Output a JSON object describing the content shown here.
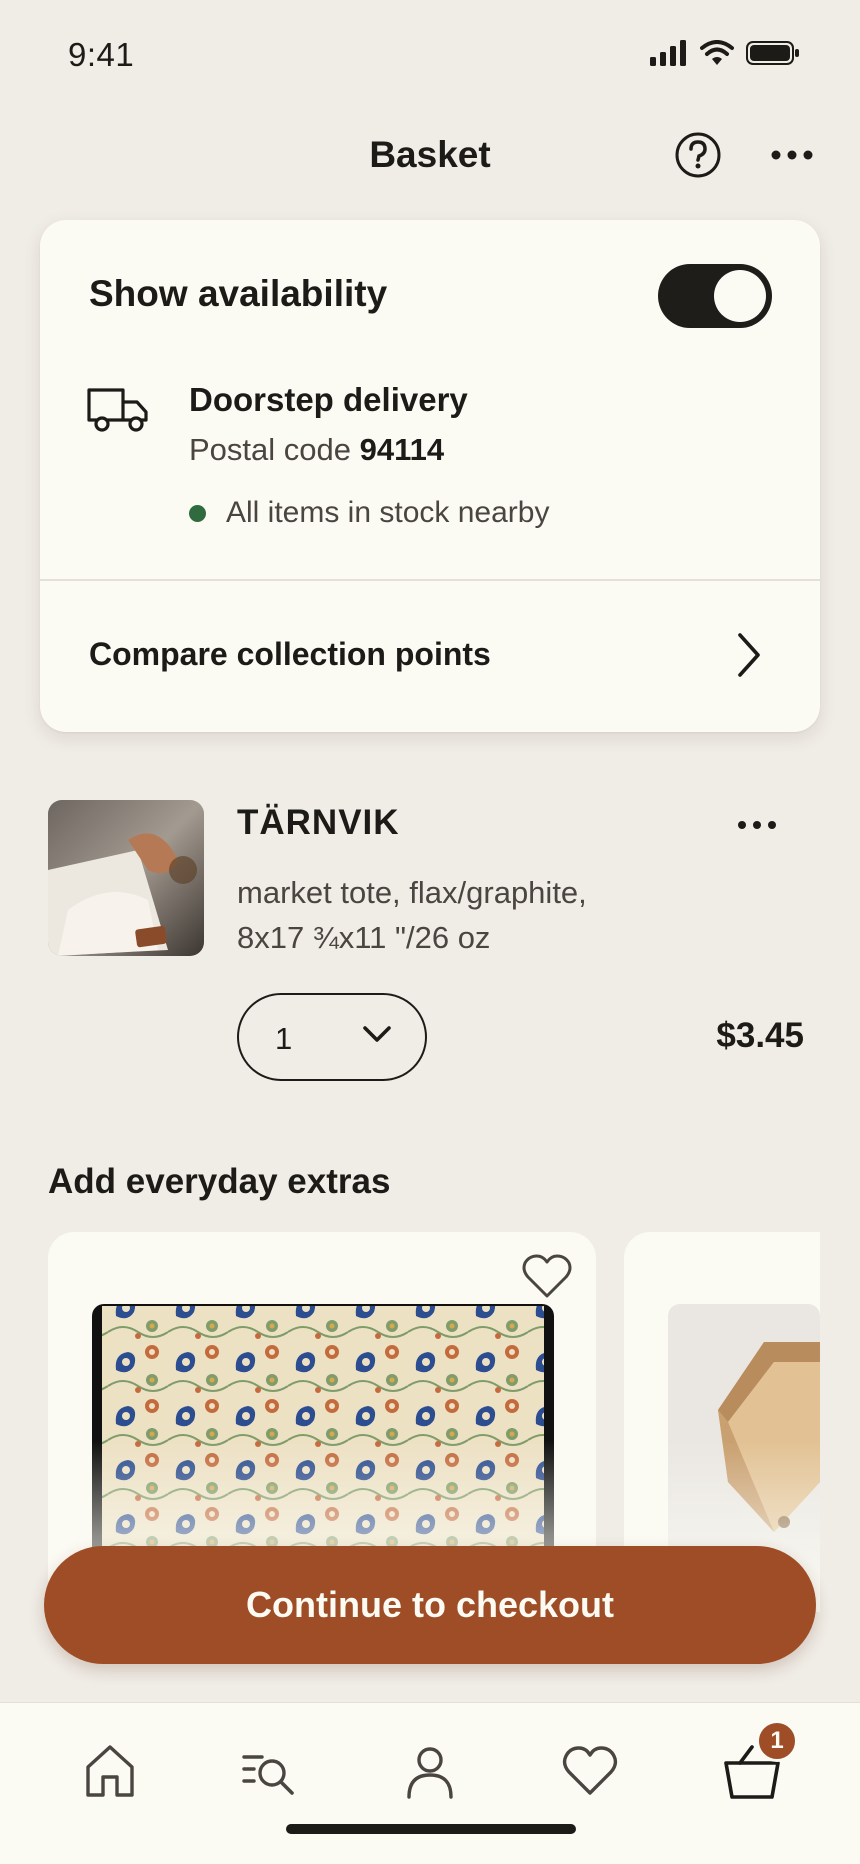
{
  "status_bar": {
    "time": "9:41"
  },
  "nav": {
    "title": "Basket"
  },
  "availability": {
    "title": "Show availability",
    "toggle_on": true,
    "delivery_title": "Doorstep delivery",
    "postal_label": "Postal code",
    "postal_code": "94114",
    "stock_text": "All items in stock nearby",
    "compare_label": "Compare collection points"
  },
  "item": {
    "name": "TÄRNVIK",
    "description": "market tote, flax/graphite, 8x17 ¾x11 \"/26 oz",
    "quantity": "1",
    "price": "$3.45"
  },
  "extras": {
    "title": "Add everyday extras"
  },
  "checkout": {
    "label": "Continue to checkout"
  },
  "tab_bar": {
    "items": [
      "home-icon",
      "search-list-icon",
      "profile-icon",
      "heart-icon",
      "basket-icon"
    ],
    "cart_badge": "1"
  },
  "colors": {
    "accent": "#9e4d26",
    "background": "#f0ece6",
    "card": "#fbfaf3",
    "stock_green": "#2f6b3e"
  }
}
